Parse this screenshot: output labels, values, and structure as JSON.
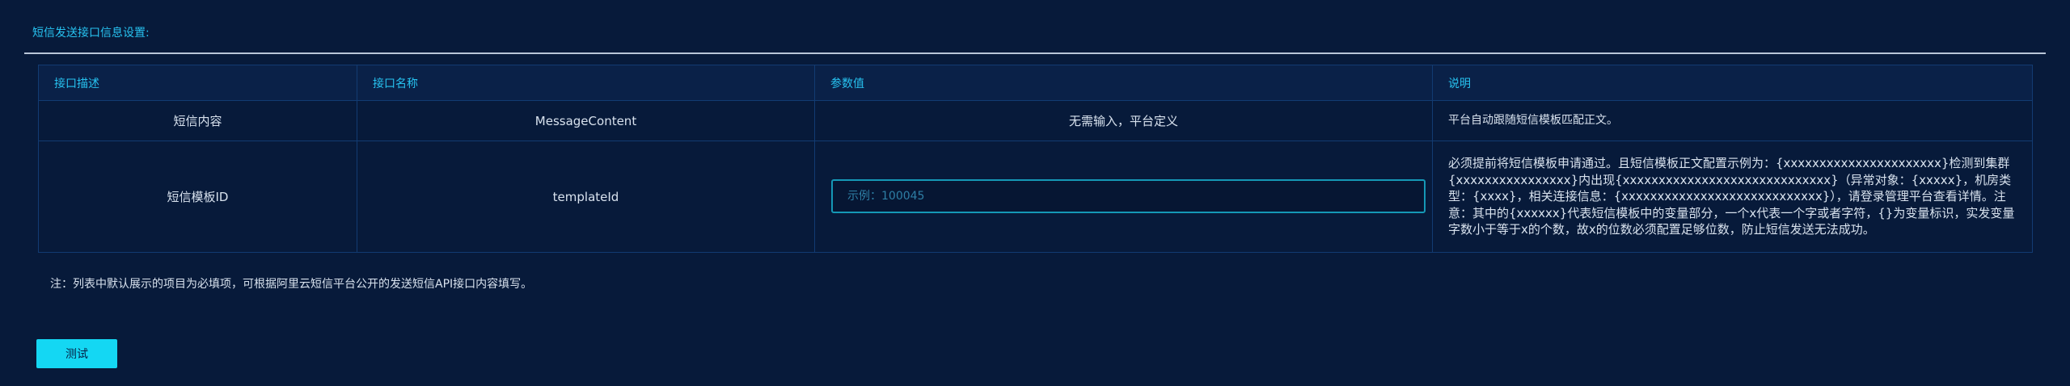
{
  "section": {
    "title": "短信发送接口信息设置:"
  },
  "table": {
    "headers": [
      "接口描述",
      "接口名称",
      "参数值",
      "说明"
    ],
    "rows": [
      {
        "description": "短信内容",
        "name": "MessageContent",
        "value_text": "无需输入，平台定义",
        "note": "平台自动跟随短信模板匹配正文。"
      },
      {
        "description": "短信模板ID",
        "name": "templateId",
        "input_value": "",
        "input_placeholder": "示例：100045",
        "note": "必须提前将短信模板申请通过。且短信模板正文配置示例为：{xxxxxxxxxxxxxxxxxxxxxx}检测到集群{xxxxxxxxxxxxxxxx}内出现{xxxxxxxxxxxxxxxxxxxxxxxxxxxxx}（异常对象：{xxxxx}，机房类型：{xxxx}，相关连接信息：{xxxxxxxxxxxxxxxxxxxxxxxxxxxx}），请登录管理平台查看详情。注意：其中的{xxxxxx}代表短信模板中的变量部分，一个x代表一个字或者字符，{}为变量标识，实发变量字数小于等于x的个数，故x的位数必须配置足够位数，防止短信发送无法成功。"
      }
    ]
  },
  "footer": {
    "note": "注：列表中默认展示的项目为必填项，可根据阿里云短信平台公开的发送短信API接口内容填写。",
    "test_button": "测试"
  },
  "colors": {
    "background": "#071a3a",
    "accent": "#27c2f0",
    "button": "#14d7f3",
    "border": "#123b72"
  }
}
